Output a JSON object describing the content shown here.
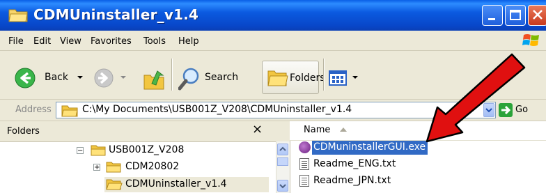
{
  "window": {
    "title": "CDMUninstaller_v1.4",
    "controls": {
      "minimize": "minimize-icon",
      "maximize": "maximize-icon",
      "close": "close-icon"
    }
  },
  "menu": {
    "items": [
      {
        "label": "File",
        "underline": "F"
      },
      {
        "label": "Edit",
        "underline": "E"
      },
      {
        "label": "View",
        "underline": "V"
      },
      {
        "label": "Favorites",
        "underline": "a"
      },
      {
        "label": "Tools",
        "underline": "T"
      },
      {
        "label": "Help",
        "underline": "H"
      }
    ]
  },
  "toolbar": {
    "back_label": "Back",
    "search_label": "Search",
    "folders_label": "Folders"
  },
  "address": {
    "label": "Address",
    "path": "C:\\My Documents\\USB001Z_V208\\CDMUninstaller_v1.4",
    "go_label": "Go"
  },
  "folders_pane": {
    "title": "Folders",
    "close_glyph": "×",
    "tree": [
      {
        "label": "USB001Z_V208",
        "expander": "−"
      },
      {
        "label": "CDM20802",
        "expander": "+"
      },
      {
        "label": "CDMUninstaller_v1.4",
        "expander": ""
      }
    ]
  },
  "files_pane": {
    "column_name": "Name",
    "files": [
      {
        "name": "CDMuninstallerGUI.exe",
        "icon": "exe-icon",
        "selected": true
      },
      {
        "name": "Readme_ENG.txt",
        "icon": "text-file-icon",
        "selected": false
      },
      {
        "name": "Readme_JPN.txt",
        "icon": "text-file-icon",
        "selected": false
      }
    ]
  },
  "colors": {
    "titlebar": "#0846c8",
    "selection": "#316ac5",
    "arrow": "#e01010"
  }
}
